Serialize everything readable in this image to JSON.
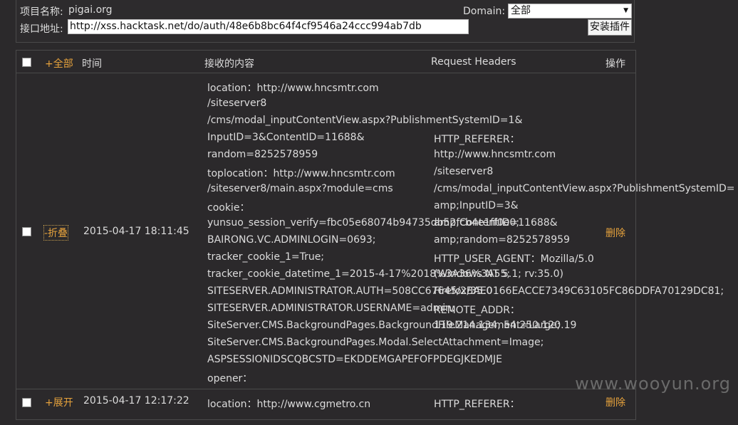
{
  "project": {
    "name_label": "项目名称:",
    "name_value": "pigai.org",
    "api_label": "接口地址:",
    "api_url": "http://xss.hacktask.net/do/auth/48e6b8bc64f4cf9546a24ccc994ab7db"
  },
  "domain": {
    "label": "Domain:",
    "selected": "全部"
  },
  "install_button": "安装插件",
  "header": {
    "all": "+全部",
    "time": "时间",
    "content": "接收的内容",
    "headers": "Request Headers",
    "action": "操作"
  },
  "rows": [
    {
      "toggle": "-折叠",
      "time": "2015-04-17 18:11:45",
      "action": "删除",
      "content_lines": [
        "location：http://www.hncsmtr.com",
        "/siteserver8",
        "/cms/modal_inputContentView.aspx?PublishmentSystemID=1&",
        "InputID=3&ContentID=11688&",
        "random=8252578959",
        "toplocation：http://www.hncsmtr.com",
        "/siteserver8/main.aspx?module=cms",
        "cookie：",
        "yunsuo_session_verify=fbc05e68074b94735db52fcb4e1ff0e0;",
        "BAIRONG.VC.ADMINLOGIN=0693;",
        "tracker_cookie_1=True;",
        "tracker_cookie_datetime_1=2015-4-17%2018%3A36%3A55;",
        "SITESERVER.ADMINISTRATOR.AUTH=508CC67645/2BAE0166EACCE7349C63105FC86DDFA70129DC81;",
        "SITESERVER.ADMINISTRATOR.USERNAME=admin;",
        "SiteServer.CMS.BackgroundPages.BackgroundFileManagement=Large;",
        "SiteServer.CMS.BackgroundPages.Modal.SelectAttachment=Image;",
        "ASPSESSIONIDSCQBCSTD=EKDDEMGAPEFOFPDEGJKEDMJE",
        "opener："
      ],
      "header_lines": [
        "HTTP_REFERER：",
        "http://www.hncsmtr.com",
        "/siteserver8",
        "/cms/modal_inputContentView.aspx?PublishmentSystemID=",
        "amp;InputID=3&",
        "amp;ContentID=11688&",
        "amp;random=8252578959",
        "HTTP_USER_AGENT：Mozilla/5.0",
        "(Windows NT 5.1; rv:35.0)",
        "Firefox/35.0",
        "REMOTE_ADDR：",
        "119.214.134, 54.250.120.19"
      ]
    },
    {
      "toggle": "+展开",
      "time": "2015-04-17 12:17:22",
      "action": "删除",
      "content_first": "location：http://www.cgmetro.cn",
      "header_first": "HTTP_REFERER："
    }
  ],
  "watermark": "www.wooyun.org"
}
